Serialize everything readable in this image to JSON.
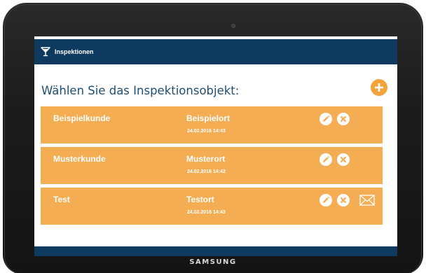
{
  "device": {
    "brand": "SAMSUNG"
  },
  "app": {
    "title": "Inspektionen",
    "icon": "cocktail-glass-icon"
  },
  "main": {
    "heading": "Wählen Sie das Inspektionsobjekt:",
    "add_icon": "plus-icon",
    "items": [
      {
        "customer": "Beispielkunde",
        "location": "Beispielort",
        "date": "24.02.2016 14:43",
        "has_mail": false
      },
      {
        "customer": "Musterkunde",
        "location": "Musterort",
        "date": "24.02.2016 14:42",
        "has_mail": false
      },
      {
        "customer": "Test",
        "location": "Testort",
        "date": "24.02.2016 14:43",
        "has_mail": true
      }
    ]
  },
  "colors": {
    "header": "#0e3a5f",
    "item_background": "#f4ad52",
    "accent": "#f2a33a",
    "heading_text": "#1e4e74"
  }
}
